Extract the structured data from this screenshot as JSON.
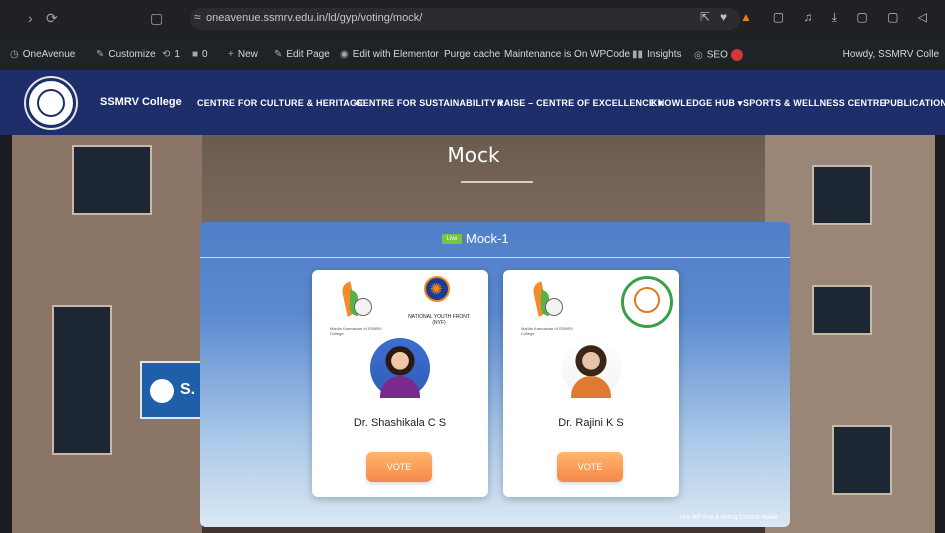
{
  "browser": {
    "url": "oneavenue.ssmrv.edu.in/ld/gyp/voting/mock/",
    "back_icon": "back-arrow-icon",
    "reload_icon": "reload-icon"
  },
  "admin_bar": {
    "site": "OneAvenue",
    "customize": "Customize",
    "updates": "1",
    "comments": "0",
    "new": "New",
    "edit_page": "Edit Page",
    "elementor": "Edit with Elementor",
    "purge": "Purge cache",
    "maintenance": "Maintenance is On",
    "wpcode": "WPCode",
    "insights": "Insights",
    "seo": "SEO",
    "howdy": "Howdy, SSMRV Colle"
  },
  "site_nav": {
    "brand": "SSMRV College",
    "items": [
      "CENTRE FOR CULTURE & HERITAGE",
      "CENTRE FOR SUSTAINABILITY ▾",
      "RAISE – CENTRE OF EXCELLENCE ▾",
      "KNOWLEDGE HUB ▾",
      "SPORTS & WELLNESS CENTRE",
      "PUBLICATIONS"
    ]
  },
  "hero": {
    "title": "Mock",
    "sign_text": "S."
  },
  "poll": {
    "badge": "Live",
    "title": "Mock-1",
    "credit": "Use WP Poll & Voting Contest Maker",
    "candidates": [
      {
        "name": "Dr. Shashikala C S",
        "logo_caption_a": "Mahila Karmakam of SSMRV College",
        "logo_caption_b": "NATIONAL YOUTH FRONT (NYF)",
        "vote_label": "VOTE"
      },
      {
        "name": "Dr. Rajini K S",
        "logo_caption_a": "Mahila Karmakam of SSMRV College",
        "logo_caption_b": "",
        "vote_label": "VOTE"
      }
    ]
  }
}
